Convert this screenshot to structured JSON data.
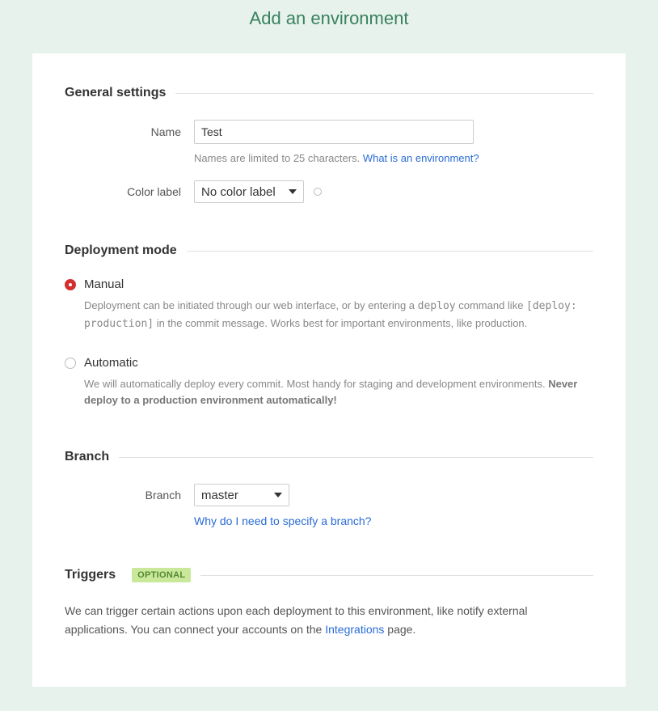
{
  "page_title": "Add an environment",
  "sections": {
    "general": {
      "title": "General settings",
      "name_label": "Name",
      "name_value": "Test",
      "name_hint_prefix": "Names are limited to 25 characters. ",
      "name_hint_link": "What is an environment?",
      "color_label": "Color label",
      "color_selected": "No color label"
    },
    "deployment": {
      "title": "Deployment mode",
      "manual": {
        "label": "Manual",
        "desc_part1": "Deployment can be initiated through our web interface, or by entering a ",
        "desc_code1": "deploy",
        "desc_part2": " command like ",
        "desc_code2": "[deploy: production]",
        "desc_part3": " in the commit message. Works best for important environments, like production."
      },
      "automatic": {
        "label": "Automatic",
        "desc_part1": "We will automatically deploy every commit. Most handy for staging and development environments. ",
        "desc_strong": "Never deploy to a production environment automatically!"
      }
    },
    "branch": {
      "title": "Branch",
      "label": "Branch",
      "selected": "master",
      "hint_link": "Why do I need to specify a branch?"
    },
    "triggers": {
      "title": "Triggers",
      "badge": "OPTIONAL",
      "desc_part1": "We can trigger certain actions upon each deployment to this environment, like notify external applications. You can connect your accounts on the ",
      "desc_link": "Integrations",
      "desc_part2": " page."
    }
  }
}
